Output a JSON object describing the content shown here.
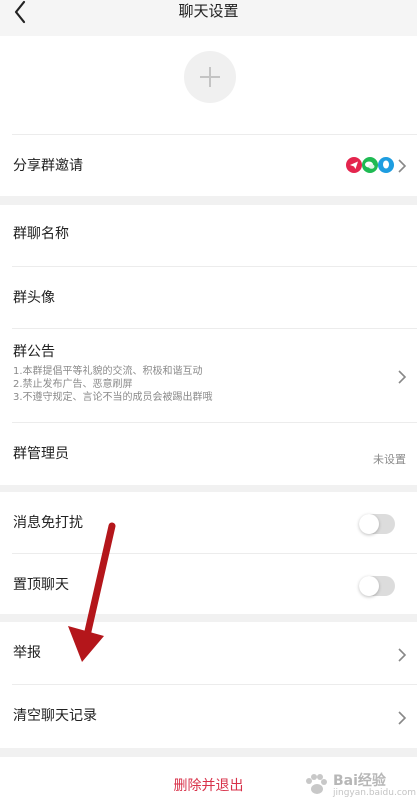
{
  "header": {
    "title": "聊天设置"
  },
  "share": {
    "label": "分享群邀请",
    "icons": [
      "telegram-share-icon",
      "wechat-share-icon",
      "qq-share-icon"
    ],
    "icon_colors": [
      "#e4254e",
      "#1fba53",
      "#1e9de0"
    ]
  },
  "group": {
    "name_label": "群聊名称",
    "avatar_label": "群头像",
    "notice_label": "群公告",
    "notice_lines": [
      "1.本群提倡平等礼貌的交流、积极和谐互动",
      "2.禁止发布广告、恶意刷屏",
      "3.不遵守规定、言论不当的成员会被踢出群哦"
    ],
    "admin_label": "群管理员",
    "admin_value": "未设置"
  },
  "settings": {
    "mute_label": "消息免打扰",
    "mute_on": false,
    "pin_label": "置顶聊天",
    "pin_on": false
  },
  "actions": {
    "report_label": "举报",
    "clear_label": "清空聊天记录",
    "exit_label": "删除并退出"
  },
  "watermark": {
    "brand": "Bai经验",
    "url": "jingyan.baidu.com"
  },
  "colors": {
    "danger": "#d8324a",
    "annotation_arrow": "#b4161b"
  }
}
